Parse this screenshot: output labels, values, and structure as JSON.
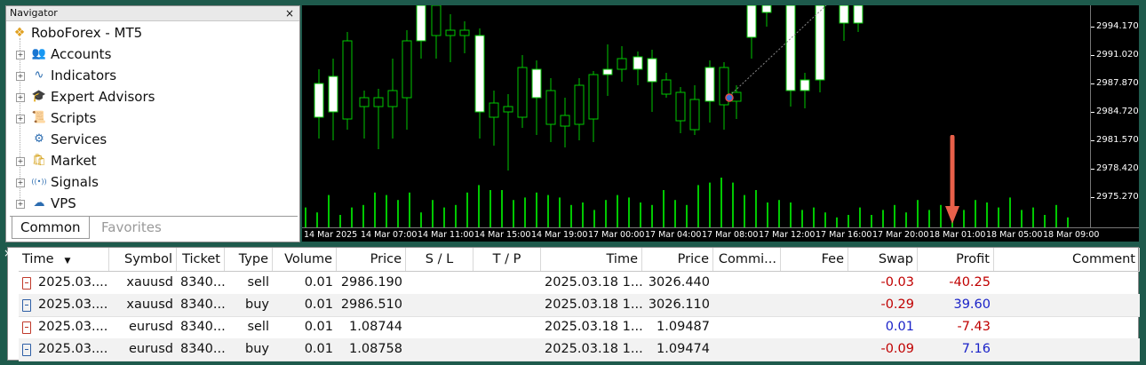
{
  "navigator": {
    "title": "Navigator",
    "close": "×",
    "root": "RoboForex - MT5",
    "items": [
      {
        "label": "Accounts",
        "icon": "accounts-icon",
        "glyph": "👥",
        "expandable": true
      },
      {
        "label": "Indicators",
        "icon": "indicators-icon",
        "glyph": "∿",
        "expandable": true
      },
      {
        "label": "Expert Advisors",
        "icon": "expert-advisors-icon",
        "glyph": "🎓",
        "expandable": true
      },
      {
        "label": "Scripts",
        "icon": "scripts-icon",
        "glyph": "📜",
        "expandable": true
      },
      {
        "label": "Services",
        "icon": "services-icon",
        "glyph": "⚙",
        "expandable": false
      },
      {
        "label": "Market",
        "icon": "market-icon",
        "glyph": "🛍",
        "expandable": true
      },
      {
        "label": "Signals",
        "icon": "signals-icon",
        "glyph": "((•))",
        "expandable": true
      },
      {
        "label": "VPS",
        "icon": "vps-icon",
        "glyph": "☁",
        "expandable": true
      }
    ],
    "tabs": {
      "common": "Common",
      "favorites": "Favorites"
    }
  },
  "chart": {
    "price_ticks": [
      "2994.170",
      "2991.020",
      "2987.870",
      "2984.720",
      "2981.570",
      "2978.420",
      "2975.270"
    ],
    "time_ticks": [
      "14 Mar 2025",
      "14 Mar 07:00",
      "14 Mar 11:00",
      "14 Mar 15:00",
      "14 Mar 19:00",
      "17 Mar 00:00",
      "17 Mar 04:00",
      "17 Mar 08:00",
      "17 Mar 12:00",
      "17 Mar 16:00",
      "17 Mar 20:00",
      "18 Mar 01:00",
      "18 Mar 05:00",
      "18 Mar 09:00"
    ],
    "colors": {
      "background": "#000000",
      "bull": "#ffffff",
      "bear": "#000000",
      "wick": "#00c800",
      "volume": "#00c800",
      "arrow": "#e8604a"
    }
  },
  "table": {
    "close": "×",
    "headers": [
      "Time",
      "Symbol",
      "Ticket",
      "Type",
      "Volume",
      "Price",
      "S / L",
      "T / P",
      "Time",
      "Price",
      "Commi...",
      "Fee",
      "Swap",
      "Profit",
      "Comment"
    ],
    "sort_glyph": "▼",
    "rows": [
      {
        "kind": "sell",
        "time": "2025.03....",
        "symbol": "xauusd",
        "ticket": "8340...",
        "type": "sell",
        "volume": "0.01",
        "price": "2986.190",
        "sl": "",
        "tp": "",
        "time2": "2025.03.18 1...",
        "price2": "3026.440",
        "commission": "",
        "fee": "",
        "swap": "-0.03",
        "profit": "-40.25",
        "comment": ""
      },
      {
        "kind": "buy",
        "time": "2025.03....",
        "symbol": "xauusd",
        "ticket": "8340...",
        "type": "buy",
        "volume": "0.01",
        "price": "2986.510",
        "sl": "",
        "tp": "",
        "time2": "2025.03.18 1...",
        "price2": "3026.110",
        "commission": "",
        "fee": "",
        "swap": "-0.29",
        "profit": "39.60",
        "comment": ""
      },
      {
        "kind": "sell",
        "time": "2025.03....",
        "symbol": "eurusd",
        "ticket": "8340...",
        "type": "sell",
        "volume": "0.01",
        "price": "1.08744",
        "sl": "",
        "tp": "",
        "time2": "2025.03.18 1...",
        "price2": "1.09487",
        "commission": "",
        "fee": "",
        "swap": "0.01",
        "profit": "-7.43",
        "comment": ""
      },
      {
        "kind": "buy",
        "time": "2025.03....",
        "symbol": "eurusd",
        "ticket": "8340...",
        "type": "buy",
        "volume": "0.01",
        "price": "1.08758",
        "sl": "",
        "tp": "",
        "time2": "2025.03.18 1...",
        "price2": "1.09474",
        "commission": "",
        "fee": "",
        "swap": "-0.09",
        "profit": "7.16",
        "comment": ""
      }
    ]
  }
}
